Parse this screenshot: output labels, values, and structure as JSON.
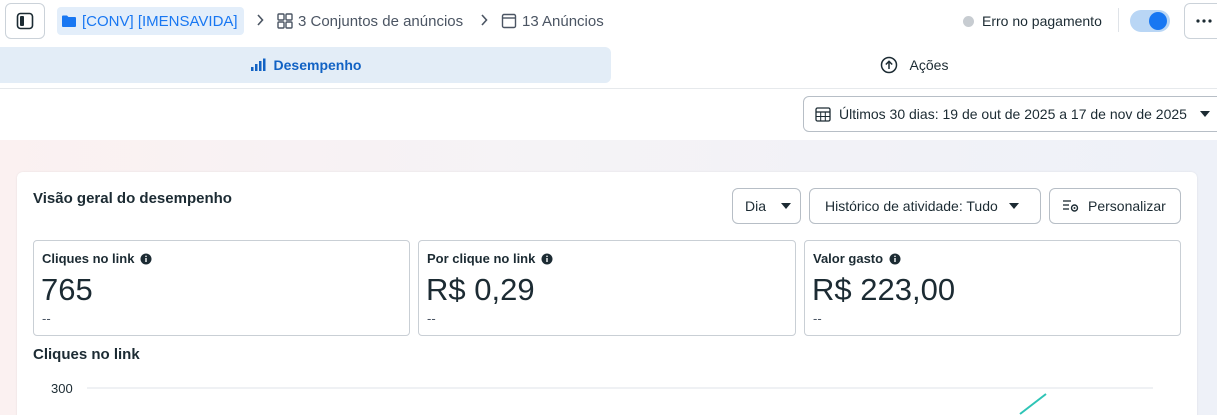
{
  "breadcrumb": {
    "campaign": "[CONV] [IMENSAVIDA]",
    "ad_sets": "3 Conjuntos de anúncios",
    "ads": "13 Anúncios"
  },
  "status": {
    "label": "Erro no pagamento",
    "toggle_on": true
  },
  "tabs": [
    {
      "label": "Desempenho",
      "active": true,
      "icon": "bar-chart-icon"
    },
    {
      "label": "Ações",
      "active": false,
      "icon": "arrow-up-circle-icon"
    }
  ],
  "date_range": {
    "label": "Últimos 30 dias: 19 de out de 2025 a 17 de nov de 2025"
  },
  "overview": {
    "title": "Visão geral do desempenho",
    "granularity": "Dia",
    "history": "Histórico de atividade: Tudo",
    "customize": "Personalizar"
  },
  "metrics": [
    {
      "label": "Cliques no link",
      "value": "765",
      "delta": "--"
    },
    {
      "label": "Por clique no link",
      "value": "R$ 0,29",
      "delta": "--"
    },
    {
      "label": "Valor gasto",
      "value": "R$ 223,00",
      "delta": "--"
    }
  ],
  "chart_data": {
    "type": "line",
    "title": "Cliques no link",
    "y_ticks": [
      "300"
    ],
    "ylim": [
      0,
      300
    ],
    "grid": true
  },
  "colors": {
    "accent": "#1877f2",
    "line": "#2ec4b6",
    "active_tab_bg": "#e3edf7"
  }
}
